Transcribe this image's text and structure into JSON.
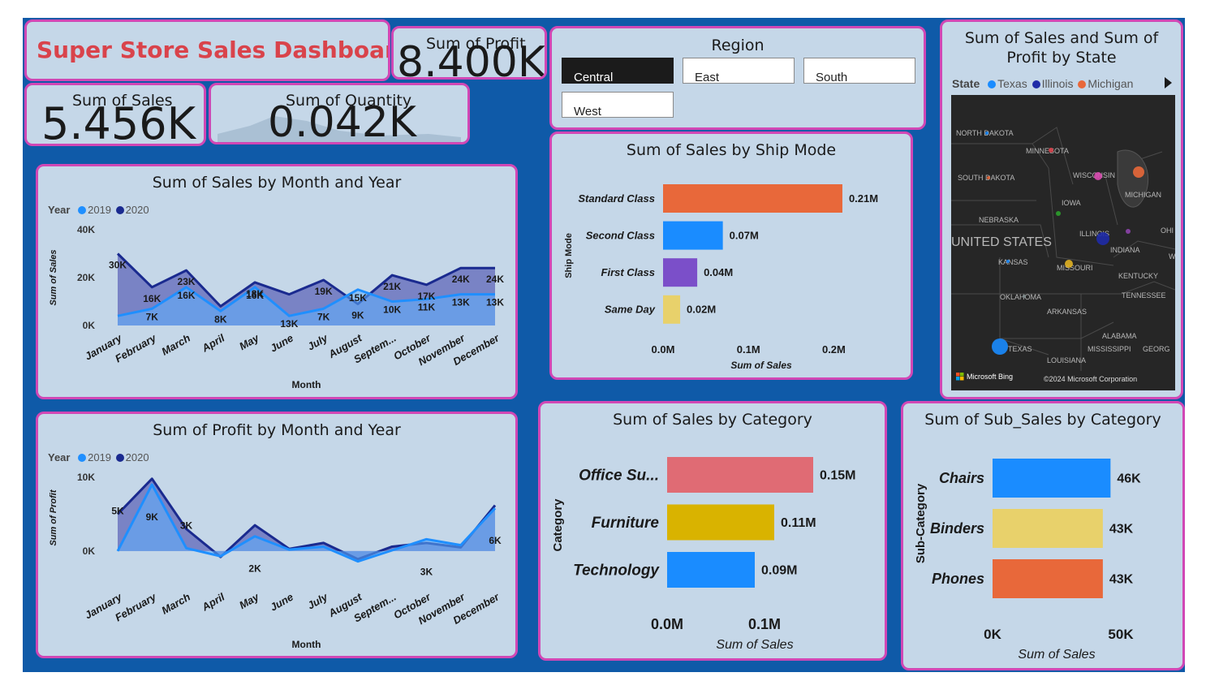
{
  "dashboard": {
    "title": "Super Store Sales Dashboard",
    "title_color": "#d9434b"
  },
  "kpis": {
    "profit": {
      "label": "Sum of Profit",
      "value": "8.400K"
    },
    "sales": {
      "label": "Sum of Sales",
      "value": "5.456K"
    },
    "quantity": {
      "label": "Sum of Quantity",
      "value": "0.042K"
    }
  },
  "region": {
    "title": "Region",
    "options": [
      "Central",
      "East",
      "South",
      "West"
    ],
    "selected": "Central"
  },
  "map": {
    "title": "Sum of Sales and Sum of Profit by State",
    "legend_title": "State",
    "legend_items": [
      {
        "name": "Texas",
        "color": "#1a8cff"
      },
      {
        "name": "Illinois",
        "color": "#1f2ba8"
      },
      {
        "name": "Michigan",
        "color": "#e8683a"
      }
    ],
    "place_labels": [
      "NORTH DAKOTA",
      "MINNESOTA",
      "SOUTH DAKOTA",
      "WISCONSIN",
      "MICHIGAN",
      "IOWA",
      "NEBRASKA",
      "UNITED STATES",
      "ILLINOIS",
      "INDIANA",
      "OHI",
      "KANSAS",
      "MISSOURI",
      "KENTUCKY",
      "OKLAHOMA",
      "TENNESSEE",
      "ARKANSAS",
      "ALABAMA",
      "TEXAS",
      "MISSISSIPPI",
      "GEORG",
      "LOUISIANA",
      "W"
    ],
    "bing_label": "Microsoft Bing",
    "copyright": "©2024 Microsoft Corporation",
    "bubble_colors": {
      "texas": "#1a8cff",
      "illinois": "#1f2ba8",
      "michigan": "#e8683a",
      "wisconsin": "#d94bb0",
      "missouri": "#e1b224",
      "minnesota": "#d9434b",
      "iowa": "#2ca02c",
      "indiana": "#8e44ad",
      "oklahoma": "#7f8c8d"
    }
  },
  "colors": {
    "y2019": "#1f8fff",
    "y2020": "#1a2a8f",
    "accent": "#d147b5"
  },
  "charts": {
    "sales_month": {
      "title": "Sum of Sales by Month and Year",
      "legend_title": "Year",
      "xlabel": "Month",
      "ylabel": "Sum of Sales",
      "y_ticks": [
        "40K",
        "20K",
        "0K"
      ],
      "months": [
        "January",
        "February",
        "March",
        "April",
        "May",
        "June",
        "July",
        "August",
        "Septem...",
        "October",
        "November",
        "December"
      ]
    },
    "profit_month": {
      "title": "Sum of Profit by Month and Year",
      "legend_title": "Year",
      "xlabel": "Month",
      "ylabel": "Sum of Profit",
      "y_ticks": [
        "10K",
        "0K"
      ],
      "months": [
        "January",
        "February",
        "March",
        "April",
        "May",
        "June",
        "July",
        "August",
        "Septem...",
        "October",
        "November",
        "December"
      ]
    },
    "ship_mode": {
      "title": "Sum of Sales by Ship Mode",
      "ylabel": "Ship Mode",
      "xlabel": "Sum of Sales",
      "x_ticks": [
        "0.0M",
        "0.1M",
        "0.2M"
      ]
    },
    "category": {
      "title": "Sum of Sales by Category",
      "ylabel": "Category",
      "xlabel": "Sum of Sales",
      "x_ticks": [
        "0.0M",
        "0.1M"
      ]
    },
    "sub_category": {
      "title": "Sum of Sub_Sales by Category",
      "ylabel": "Sub-Category",
      "xlabel": "Sum of Sales",
      "x_ticks": [
        "0K",
        "50K"
      ]
    }
  },
  "chart_data": [
    {
      "type": "area",
      "title": "Sum of Sales by Month and Year",
      "xlabel": "Month",
      "ylabel": "Sum of Sales",
      "ylim": [
        0,
        40000
      ],
      "categories": [
        "January",
        "February",
        "March",
        "April",
        "May",
        "June",
        "July",
        "August",
        "Septem...",
        "October",
        "November",
        "December"
      ],
      "legend": "top-left",
      "series": [
        {
          "name": "2019",
          "values": [
            4000,
            7000,
            16000,
            6000,
            16000,
            4000,
            7000,
            15000,
            10000,
            11000,
            13000,
            13000
          ],
          "labels": [
            "",
            "7K",
            "16K",
            "8K",
            "16K",
            "13K",
            "7K",
            "15K",
            "10K",
            "11K",
            "13K",
            "13K"
          ]
        },
        {
          "name": "2020",
          "values": [
            30000,
            16000,
            23000,
            8000,
            18000,
            13000,
            19000,
            9000,
            21000,
            17000,
            24000,
            24000
          ],
          "labels": [
            "30K",
            "16K",
            "23K",
            "",
            "18K",
            "",
            "19K",
            "9K",
            "21K",
            "17K",
            "24K",
            "24K"
          ]
        }
      ]
    },
    {
      "type": "area",
      "title": "Sum of Profit by Month and Year",
      "xlabel": "Month",
      "ylabel": "Sum of Profit",
      "ylim": [
        -1000,
        10000
      ],
      "categories": [
        "January",
        "February",
        "March",
        "April",
        "May",
        "June",
        "July",
        "August",
        "Septem...",
        "October",
        "November",
        "December"
      ],
      "legend": "top-left",
      "series": [
        {
          "name": "2019",
          "values": [
            0,
            9000,
            400,
            -700,
            2000,
            200,
            600,
            -1400,
            100,
            1600,
            800,
            5800
          ],
          "labels": [
            "",
            "9K",
            "",
            "",
            "2K",
            "",
            "",
            "",
            "",
            "3K",
            "",
            "6K"
          ]
        },
        {
          "name": "2020",
          "values": [
            5000,
            9800,
            3000,
            -800,
            3500,
            300,
            1100,
            -1100,
            600,
            1100,
            500,
            6200
          ],
          "labels": [
            "5K",
            "",
            "3K",
            "",
            "",
            "",
            "",
            "",
            "",
            "",
            "",
            ""
          ]
        }
      ]
    },
    {
      "type": "bar",
      "title": "Sum of Sales by Ship Mode",
      "xlabel": "Sum of Sales",
      "ylabel": "Ship Mode",
      "xlim": [
        0,
        0.23
      ],
      "categories": [
        "Standard Class",
        "Second Class",
        "First Class",
        "Same Day"
      ],
      "values": [
        0.21,
        0.07,
        0.04,
        0.02
      ],
      "value_labels": [
        "0.21M",
        "0.07M",
        "0.04M",
        "0.02M"
      ],
      "colors": [
        "#e8683a",
        "#1a8cff",
        "#7b4fc9",
        "#e8d16b"
      ]
    },
    {
      "type": "bar",
      "title": "Sum of Sales by Category",
      "xlabel": "Sum of Sales",
      "ylabel": "Category",
      "xlim": [
        0,
        0.18
      ],
      "categories": [
        "Office Su...",
        "Furniture",
        "Technology"
      ],
      "values": [
        0.15,
        0.11,
        0.09
      ],
      "value_labels": [
        "0.15M",
        "0.11M",
        "0.09M"
      ],
      "colors": [
        "#e06b74",
        "#d9b300",
        "#1a8cff"
      ]
    },
    {
      "type": "bar",
      "title": "Sum of Sub_Sales by Category",
      "xlabel": "Sum of Sales",
      "ylabel": "Sub-Category",
      "xlim": [
        0,
        50000
      ],
      "categories": [
        "Chairs",
        "Binders",
        "Phones"
      ],
      "values": [
        46000,
        43000,
        43000
      ],
      "value_labels": [
        "46K",
        "43K",
        "43K"
      ],
      "colors": [
        "#1a8cff",
        "#e8d16b",
        "#e8683a"
      ]
    }
  ]
}
